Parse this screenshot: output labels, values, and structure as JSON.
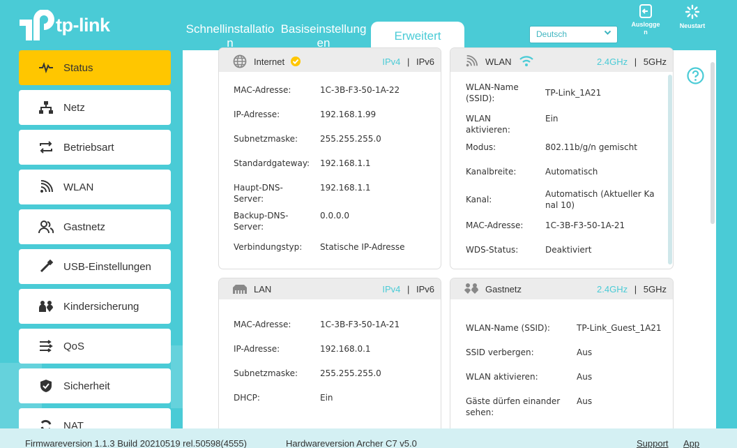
{
  "brand": {
    "logo_text": "tp-link"
  },
  "tabs": {
    "quick": "Schnellinstallation",
    "basic": "Basiseinstellungen",
    "advanced": "Erweitert"
  },
  "language": {
    "selected": "Deutsch"
  },
  "top": {
    "logout": "Ausloggen",
    "reboot": "Neustart"
  },
  "sidebar": {
    "items": [
      {
        "label": "Status",
        "icon": "pulse-icon",
        "active": true
      },
      {
        "label": "Netz",
        "icon": "network-icon"
      },
      {
        "label": "Betriebsart",
        "icon": "mode-switch-icon"
      },
      {
        "label": "WLAN",
        "icon": "wifi-icon"
      },
      {
        "label": "Gastnetz",
        "icon": "guests-icon"
      },
      {
        "label": "USB-Einstellungen",
        "icon": "usb-icon"
      },
      {
        "label": "Kindersicherung",
        "icon": "family-icon"
      },
      {
        "label": "QoS",
        "icon": "qos-icon"
      },
      {
        "label": "Sicherheit",
        "icon": "shield-icon"
      },
      {
        "label": "NAT",
        "icon": "nat-icon"
      }
    ]
  },
  "internet": {
    "title": "Internet",
    "ipv4": "IPv4",
    "ipv6": "IPv6",
    "sep": "|",
    "rows": [
      {
        "label": "MAC-Adresse:",
        "value": "1C-3B-F3-50-1A-22"
      },
      {
        "label": "IP-Adresse:",
        "value": "192.168.1.99"
      },
      {
        "label": "Subnetzmaske:",
        "value": "255.255.255.0"
      },
      {
        "label": "Standardgateway:",
        "value": "192.168.1.1"
      },
      {
        "label": "Haupt-DNS-Server:",
        "value": "192.168.1.1"
      },
      {
        "label": "Backup-DNS-Server:",
        "value": "0.0.0.0"
      },
      {
        "label": "Verbindungstyp:",
        "value": "Statische IP-Adresse"
      }
    ]
  },
  "wlan": {
    "title": "WLAN",
    "band1": "2.4GHz",
    "band2": "5GHz",
    "sep": "|",
    "rows": [
      {
        "label": "WLAN-Name (SSID):",
        "value": "TP-Link_1A21"
      },
      {
        "label": "WLAN aktivieren:",
        "value": "Ein"
      },
      {
        "label": "Modus:",
        "value": "802.11b/g/n gemischt"
      },
      {
        "label": "Kanalbreite:",
        "value": "Automatisch"
      },
      {
        "label": "Kanal:",
        "value": "Automatisch (Aktueller Kanal 10)"
      },
      {
        "label": "MAC-Adresse:",
        "value": "1C-3B-F3-50-1A-21"
      },
      {
        "label": "WDS-Status:",
        "value": "Deaktiviert"
      }
    ]
  },
  "lan": {
    "title": "LAN",
    "ipv4": "IPv4",
    "ipv6": "IPv6",
    "sep": "|",
    "rows": [
      {
        "label": "MAC-Adresse:",
        "value": "1C-3B-F3-50-1A-21"
      },
      {
        "label": "IP-Adresse:",
        "value": "192.168.0.1"
      },
      {
        "label": "Subnetzmaske:",
        "value": "255.255.255.0"
      },
      {
        "label": "DHCP:",
        "value": "Ein"
      }
    ]
  },
  "guest": {
    "title": "Gastnetz",
    "band1": "2.4GHz",
    "band2": "5GHz",
    "sep": "|",
    "rows": [
      {
        "label": "WLAN-Name (SSID):",
        "value": "TP-Link_Guest_1A21"
      },
      {
        "label": "SSID verbergen:",
        "value": "Aus"
      },
      {
        "label": "WLAN aktivieren:",
        "value": "Aus"
      },
      {
        "label": "Gäste dürfen einander sehen:",
        "value": "Aus"
      }
    ]
  },
  "footer": {
    "firmware": "Firmwareversion 1.1.3 Build 20210519 rel.50598(4555)",
    "hardware": "Hardwareversion Archer C7 v5.0",
    "support": "Support",
    "app": "App"
  },
  "colors": {
    "accent": "#4acbd6",
    "active": "#ffc600"
  }
}
